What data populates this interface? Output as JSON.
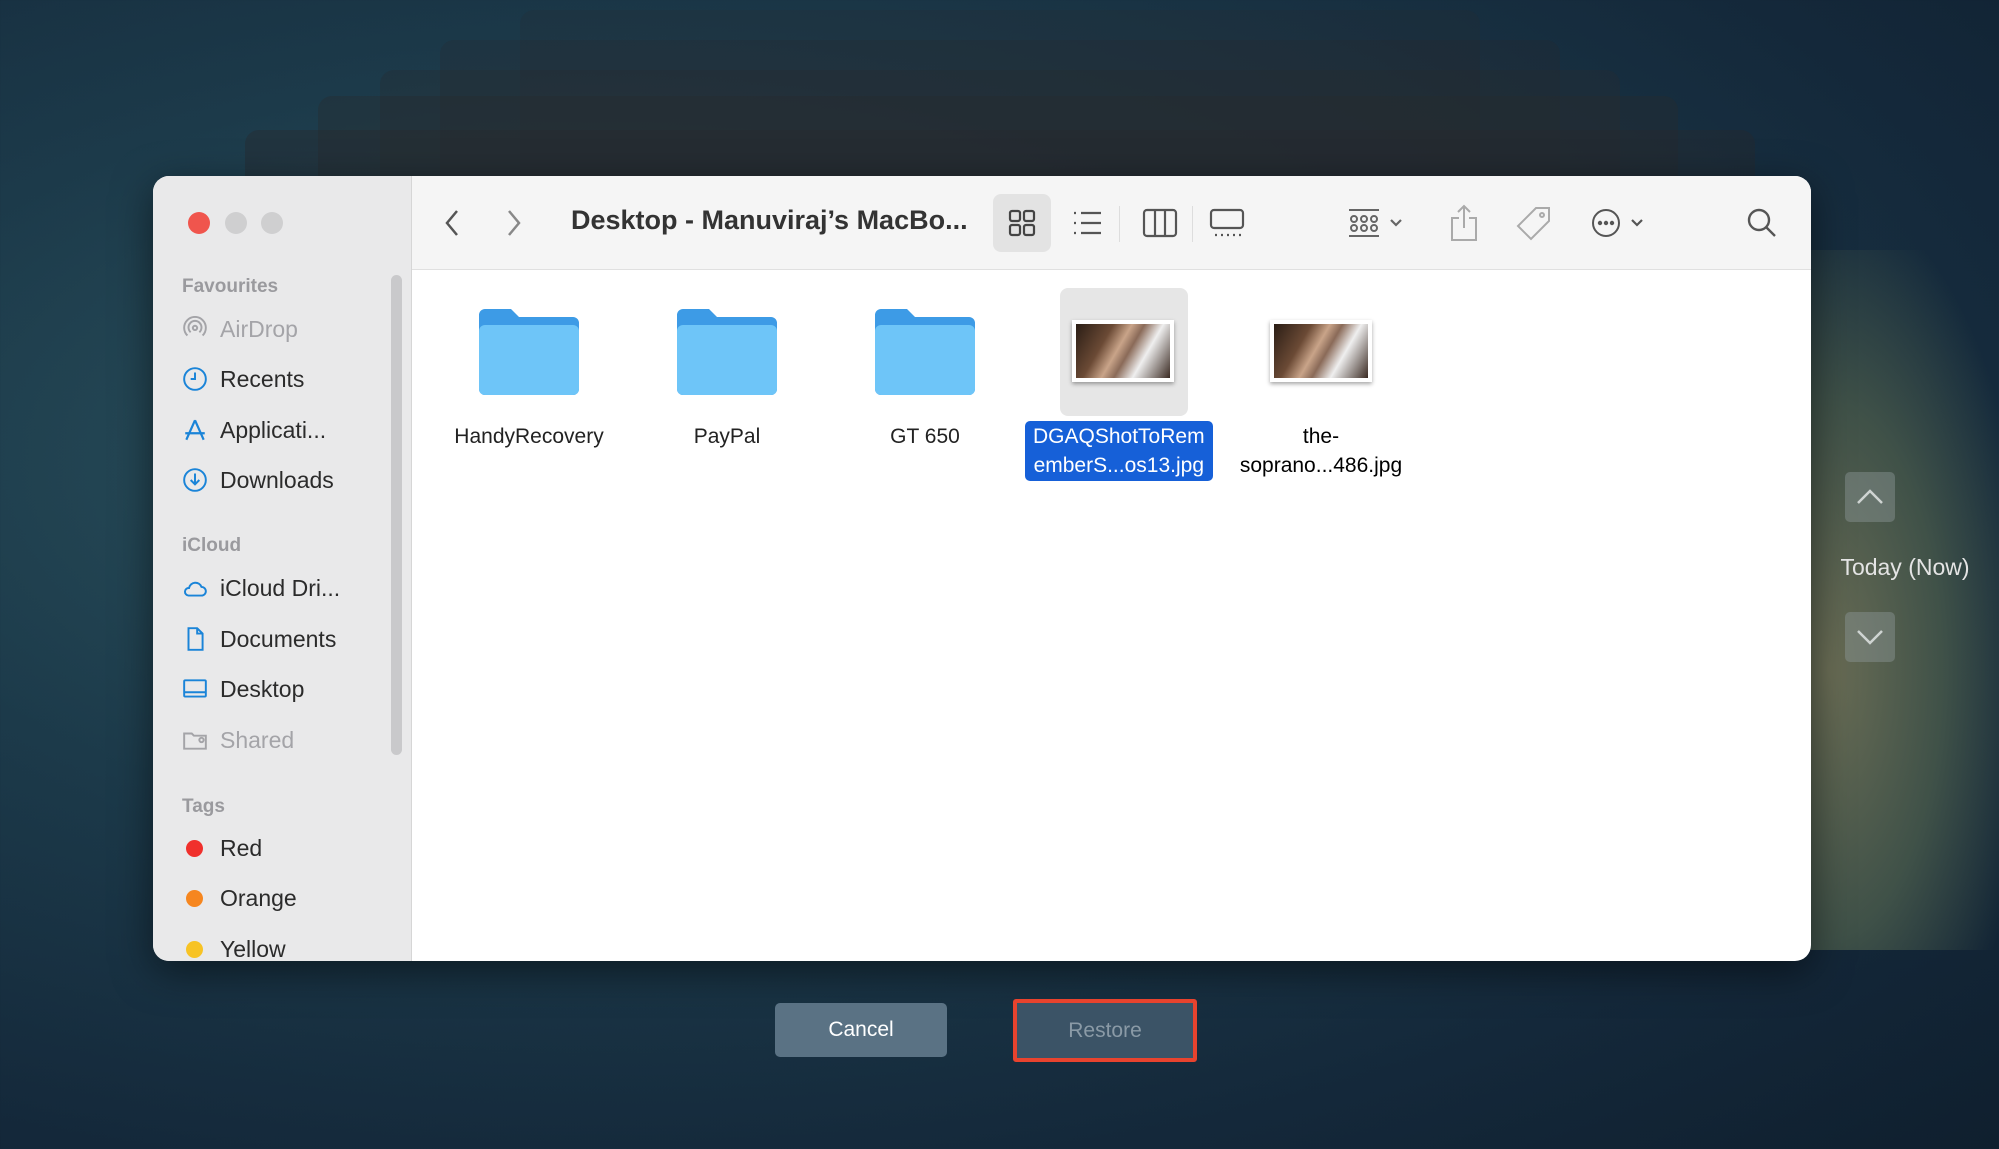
{
  "window": {
    "title": "Desktop - Manuviraj’s MacBo..."
  },
  "sidebar": {
    "favourites_header": "Favourites",
    "favourites": [
      {
        "label": "AirDrop",
        "icon": "airdrop-icon"
      },
      {
        "label": "Recents",
        "icon": "clock-icon"
      },
      {
        "label": "Applicati...",
        "icon": "applications-icon"
      },
      {
        "label": "Downloads",
        "icon": "download-icon"
      }
    ],
    "icloud_header": "iCloud",
    "icloud": [
      {
        "label": "iCloud Dri...",
        "icon": "cloud-icon"
      },
      {
        "label": "Documents",
        "icon": "document-icon"
      },
      {
        "label": "Desktop",
        "icon": "desktop-icon"
      },
      {
        "label": "Shared",
        "icon": "shared-folder-icon"
      }
    ],
    "tags_header": "Tags",
    "tags": [
      {
        "label": "Red",
        "color": "#f0302c"
      },
      {
        "label": "Orange",
        "color": "#f6861f"
      },
      {
        "label": "Yellow",
        "color": "#f7c325"
      }
    ]
  },
  "files": [
    {
      "name": "HandyRecovery",
      "type": "folder"
    },
    {
      "name": "PayPal",
      "type": "folder"
    },
    {
      "name": "GT 650",
      "type": "folder"
    },
    {
      "name_line1": "DGAQShotToRem",
      "name_line2": "emberS...os13.jpg",
      "type": "image",
      "selected": true
    },
    {
      "name_line1": "the-",
      "name_line2": "soprano...486.jpg",
      "type": "image"
    }
  ],
  "timeline": {
    "label": "Today (Now)"
  },
  "buttons": {
    "cancel": "Cancel",
    "restore": "Restore"
  },
  "colors": {
    "accent": "#1660d8",
    "highlight": "#e8432e"
  }
}
